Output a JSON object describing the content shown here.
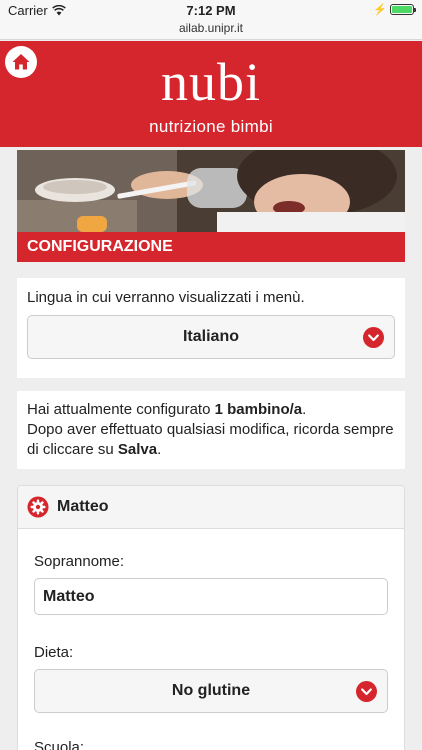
{
  "status": {
    "carrier": "Carrier",
    "time": "7:12 PM",
    "battery_pct": "",
    "battery_level": 1.0,
    "url": "ailab.unipr.it"
  },
  "header": {
    "brand": "nubi",
    "tagline": "nutrizione bimbi",
    "home_icon": "home-icon"
  },
  "section": {
    "title": "CONFIGURAZIONE"
  },
  "language": {
    "label": "Lingua in cui verranno visualizzati i menù.",
    "selected": "Italiano"
  },
  "info": {
    "line1_prefix": "Hai attualmente configurato ",
    "line1_bold": "1 bambino/a",
    "line1_suffix": ".",
    "line2": "Dopo aver effettuato qualsiasi modifica, ricorda sempre di cliccare su ",
    "line2_bold": "Salva",
    "line2_suffix": "."
  },
  "child": {
    "name": "Matteo",
    "nickname_label": "Soprannome:",
    "nickname_value": "Matteo",
    "diet_label": "Dieta:",
    "diet_selected": "No glutine",
    "school_label": "Scuola:"
  },
  "colors": {
    "brand_red": "#d6262d",
    "page_bg": "#eeeeee"
  }
}
